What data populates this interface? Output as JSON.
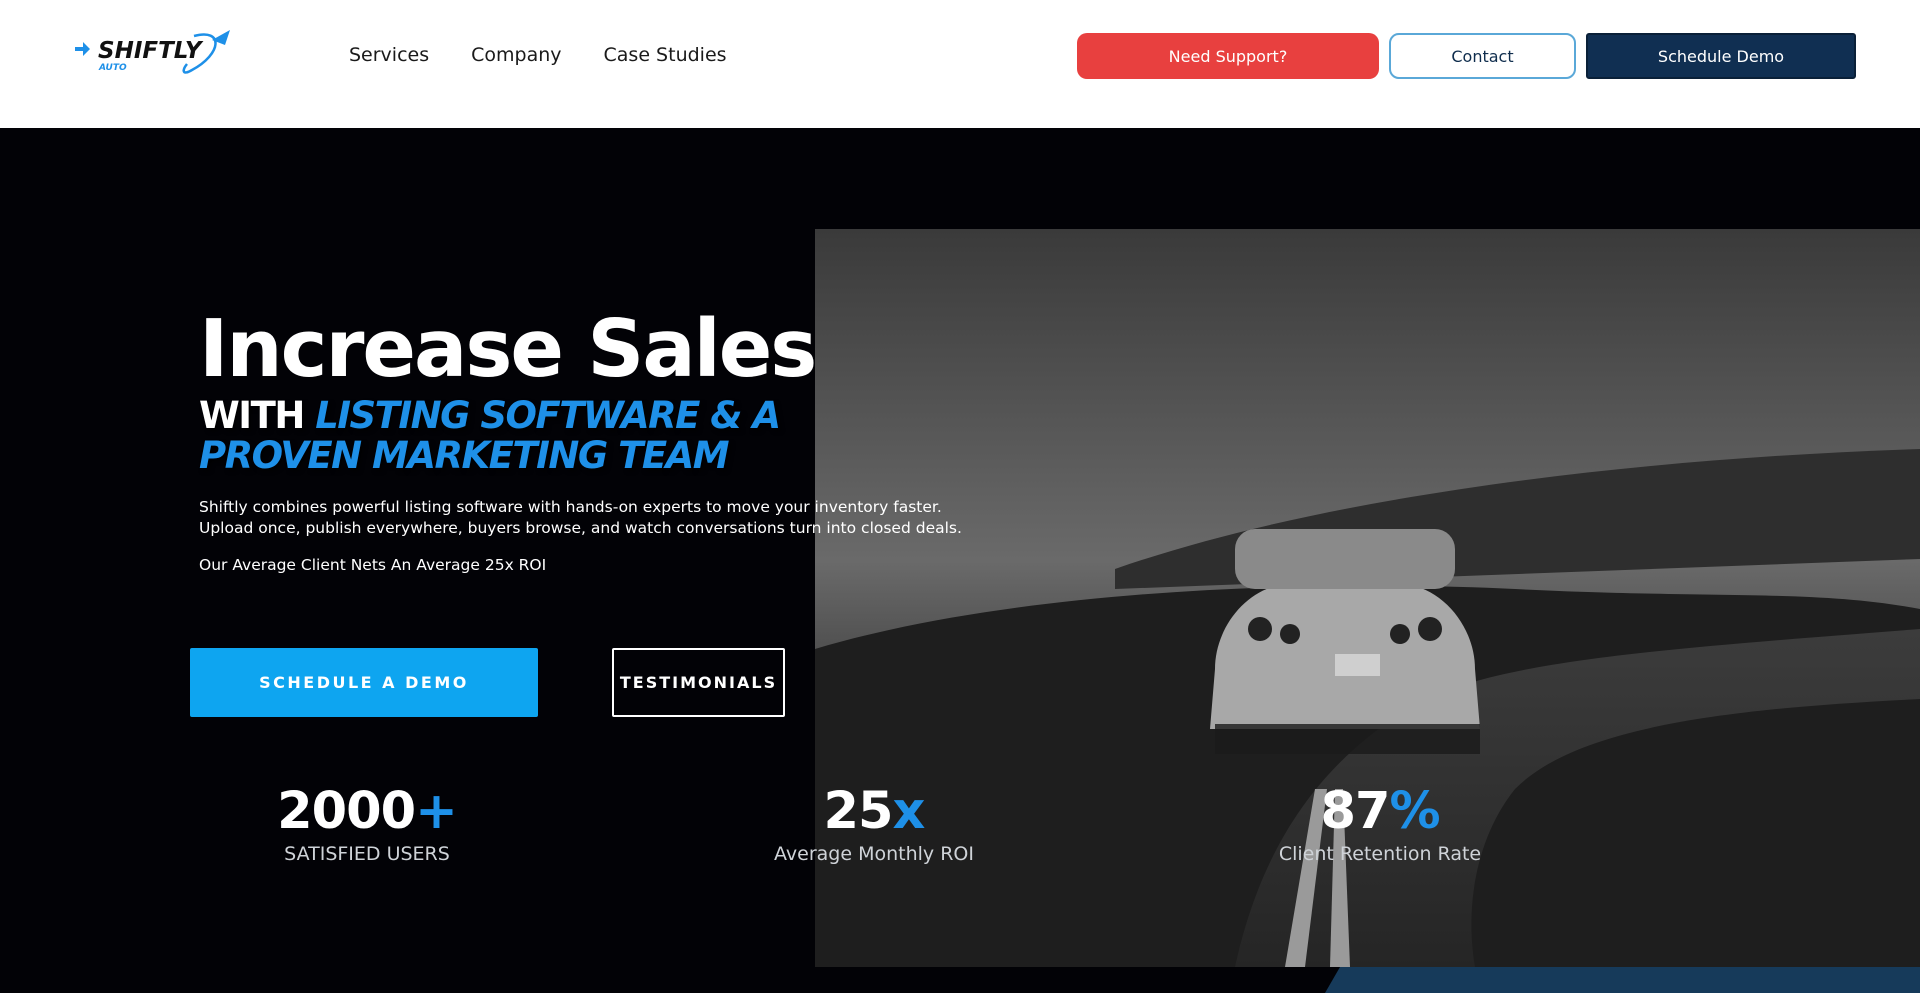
{
  "brand": {
    "name": "SHIFTLY",
    "sub": "AUTO",
    "accent": "#1e90e8"
  },
  "nav": {
    "items": [
      "Services",
      "Company",
      "Case Studies"
    ]
  },
  "header_buttons": {
    "support": "Need Support?",
    "contact": "Contact",
    "demo": "Schedule Demo"
  },
  "hero": {
    "title": "Increase Sales",
    "subtitle_lead": "WITH",
    "subtitle_accent": "LISTING SOFTWARE & A PROVEN MARKETING TEAM",
    "description": "Shiftly combines powerful listing software with hands-on experts to move your inventory faster. Upload once, publish everywhere, buyers browse, and watch conversations turn into closed deals.",
    "roi_note": "Our Average Client Nets An Average 25x ROI",
    "cta_primary": "SCHEDULE A DEMO",
    "cta_secondary": "TESTIMONIALS",
    "image": "car-on-road-photo"
  },
  "stats": [
    {
      "value": "2000",
      "suffix": "+",
      "label": "SATISFIED USERS"
    },
    {
      "value": "25",
      "suffix": "x",
      "label": "Average Monthly ROI"
    },
    {
      "value": "87",
      "suffix": "%",
      "label": "Client Retention Rate"
    }
  ],
  "colors": {
    "support_btn": "#e8403f",
    "demo_btn": "#102f52",
    "cta": "#0ea5f0",
    "hero_bg": "#020206"
  }
}
